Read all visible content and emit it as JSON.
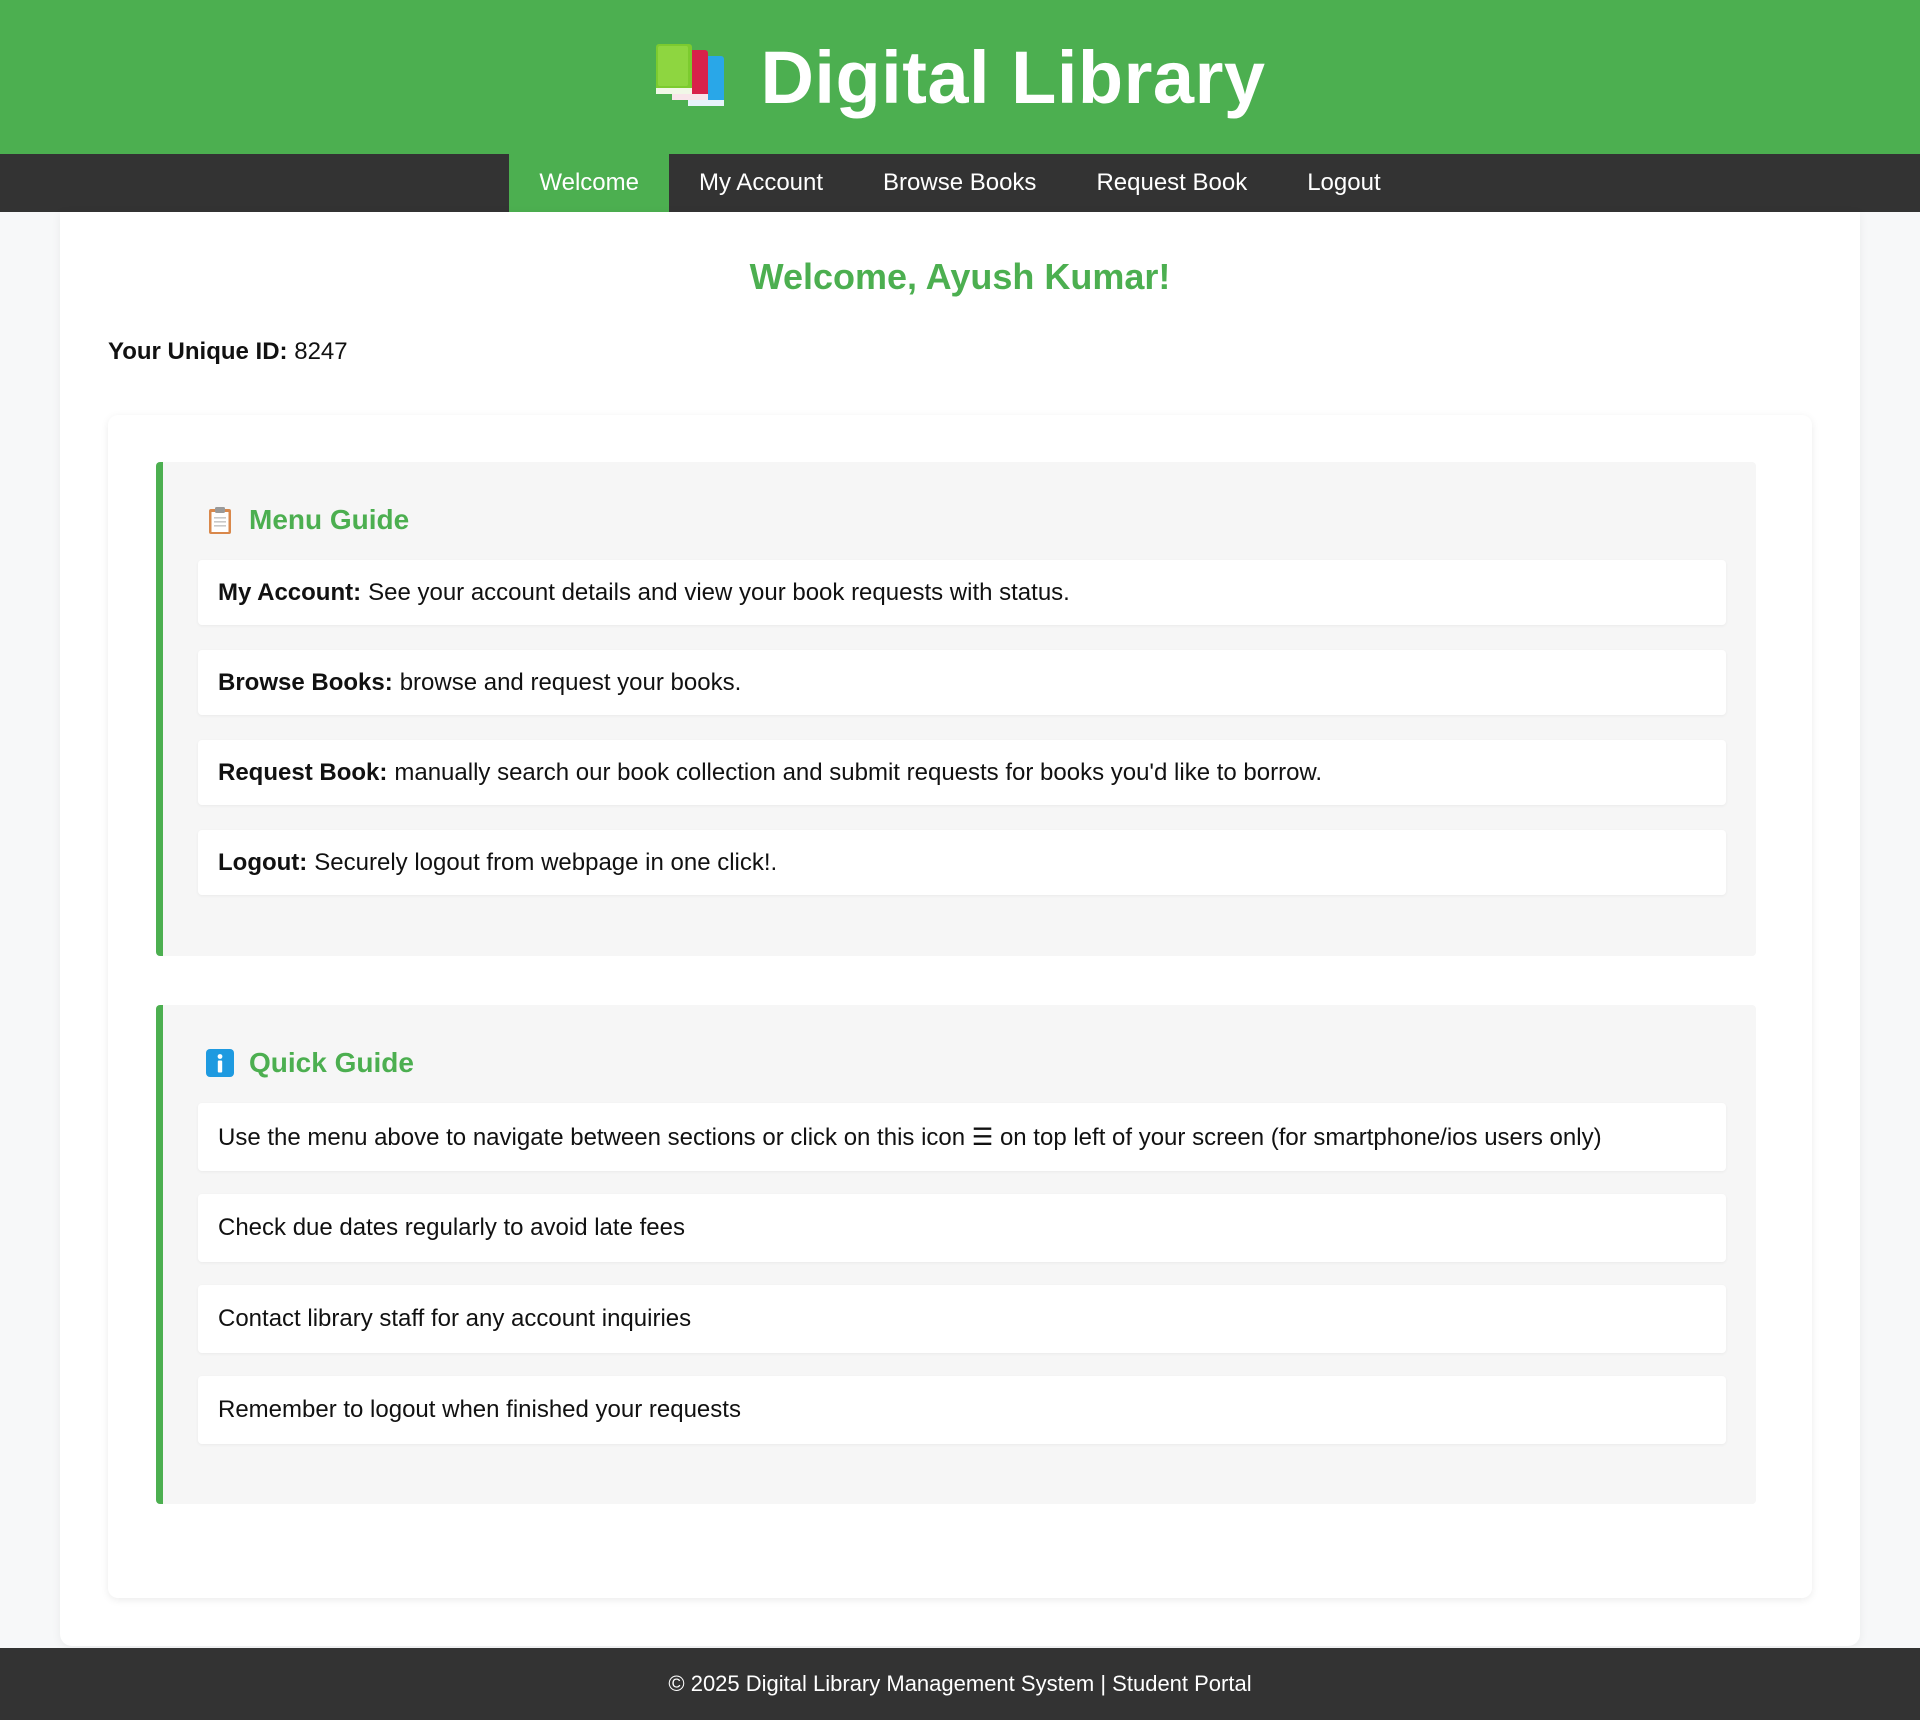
{
  "header": {
    "title": "Digital Library",
    "icon": "books-icon"
  },
  "nav": {
    "items": [
      {
        "label": "Welcome",
        "active": true
      },
      {
        "label": "My Account",
        "active": false
      },
      {
        "label": "Browse Books",
        "active": false
      },
      {
        "label": "Request Book",
        "active": false
      },
      {
        "label": "Logout",
        "active": false
      }
    ]
  },
  "welcome": {
    "title": "Welcome, Ayush Kumar!",
    "id_label": "Your Unique ID:",
    "id_value": "8247"
  },
  "menu_guide": {
    "icon": "clipboard-icon",
    "title": "Menu Guide",
    "items": [
      {
        "term": "My Account:",
        "text": "See your account details and view your book requests with status."
      },
      {
        "term": "Browse Books:",
        "text": "browse and request your books."
      },
      {
        "term": "Request Book:",
        "text": "manually search our book collection and submit requests for books you'd like to borrow."
      },
      {
        "term": "Logout:",
        "text": "Securely logout from webpage in one click!."
      }
    ]
  },
  "quick_guide": {
    "icon": "info-icon",
    "title": "Quick Guide",
    "items": [
      {
        "text": "Use the menu above to navigate between sections or click on this icon ☰ on top left of your screen (for smartphone/ios users only)"
      },
      {
        "text": "Check due dates regularly to avoid late fees"
      },
      {
        "text": "Contact library staff for any account inquiries"
      },
      {
        "text": "Remember to logout when finished your requests"
      }
    ]
  },
  "footer": {
    "text": "© 2025 Digital Library Management System | Student Portal"
  },
  "colors": {
    "brand_green": "#4caf50",
    "nav_dark": "#333333",
    "section_bg": "#f6f6f6",
    "page_bg": "#f7f8f9"
  }
}
